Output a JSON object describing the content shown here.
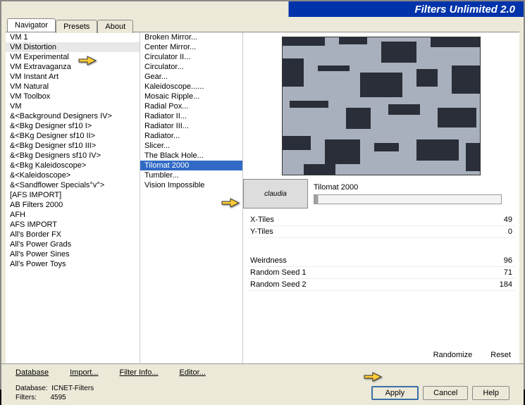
{
  "title": "Filters Unlimited 2.0",
  "tabs": [
    "Navigator",
    "Presets",
    "About"
  ],
  "categories": [
    "VM 1",
    "VM Distortion",
    "VM Experimental",
    "VM Extravaganza",
    "VM Instant Art",
    "VM Natural",
    "VM Toolbox",
    "VM",
    "&<Background Designers IV>",
    "&<Bkg Designer sf10 I>",
    "&<BKg Designer sf10 II>",
    "&<Bkg Designer sf10 III>",
    "&<Bkg Designers sf10 IV>",
    "&<Bkg Kaleidoscope>",
    "&<Kaleidoscope>",
    "&<Sandflower Specials°v°>",
    "[AFS IMPORT]",
    "AB Filters 2000",
    "AFH",
    "AFS IMPORT",
    "All's Border FX",
    "All's Power Grads",
    "All's Power Sines",
    "All's Power Toys"
  ],
  "cat_hover_index": 1,
  "filters": [
    "Broken Mirror...",
    "Center Mirror...",
    "Circulator II...",
    "Circulator...",
    "Gear...",
    "Kaleidoscope......",
    "Mosaic Ripple...",
    "Radial Pox...",
    "Radiator II...",
    "Radiator III...",
    "Radiator...",
    "Slicer...",
    "The Black Hole...",
    "Tilomat 2000",
    "Tumbler...",
    "Vision Impossible"
  ],
  "filter_selected_index": 13,
  "filter_title": "Tilomat 2000",
  "badge_text": "claudia",
  "params": [
    {
      "label": "X-Tiles",
      "value": "49"
    },
    {
      "label": "Y-Tiles",
      "value": "0"
    }
  ],
  "params2": [
    {
      "label": "Weirdness",
      "value": "96"
    },
    {
      "label": "Random Seed 1",
      "value": "71"
    },
    {
      "label": "Random Seed 2",
      "value": "184"
    }
  ],
  "rand": "Randomize",
  "reset": "Reset",
  "links": [
    "Database",
    "Import...",
    "Filter Info...",
    "Editor..."
  ],
  "status": {
    "db_label": "Database:",
    "db": "ICNET-Filters",
    "filters_label": "Filters:",
    "filters": "4595"
  },
  "buttons": {
    "apply": "Apply",
    "cancel": "Cancel",
    "help": "Help"
  }
}
